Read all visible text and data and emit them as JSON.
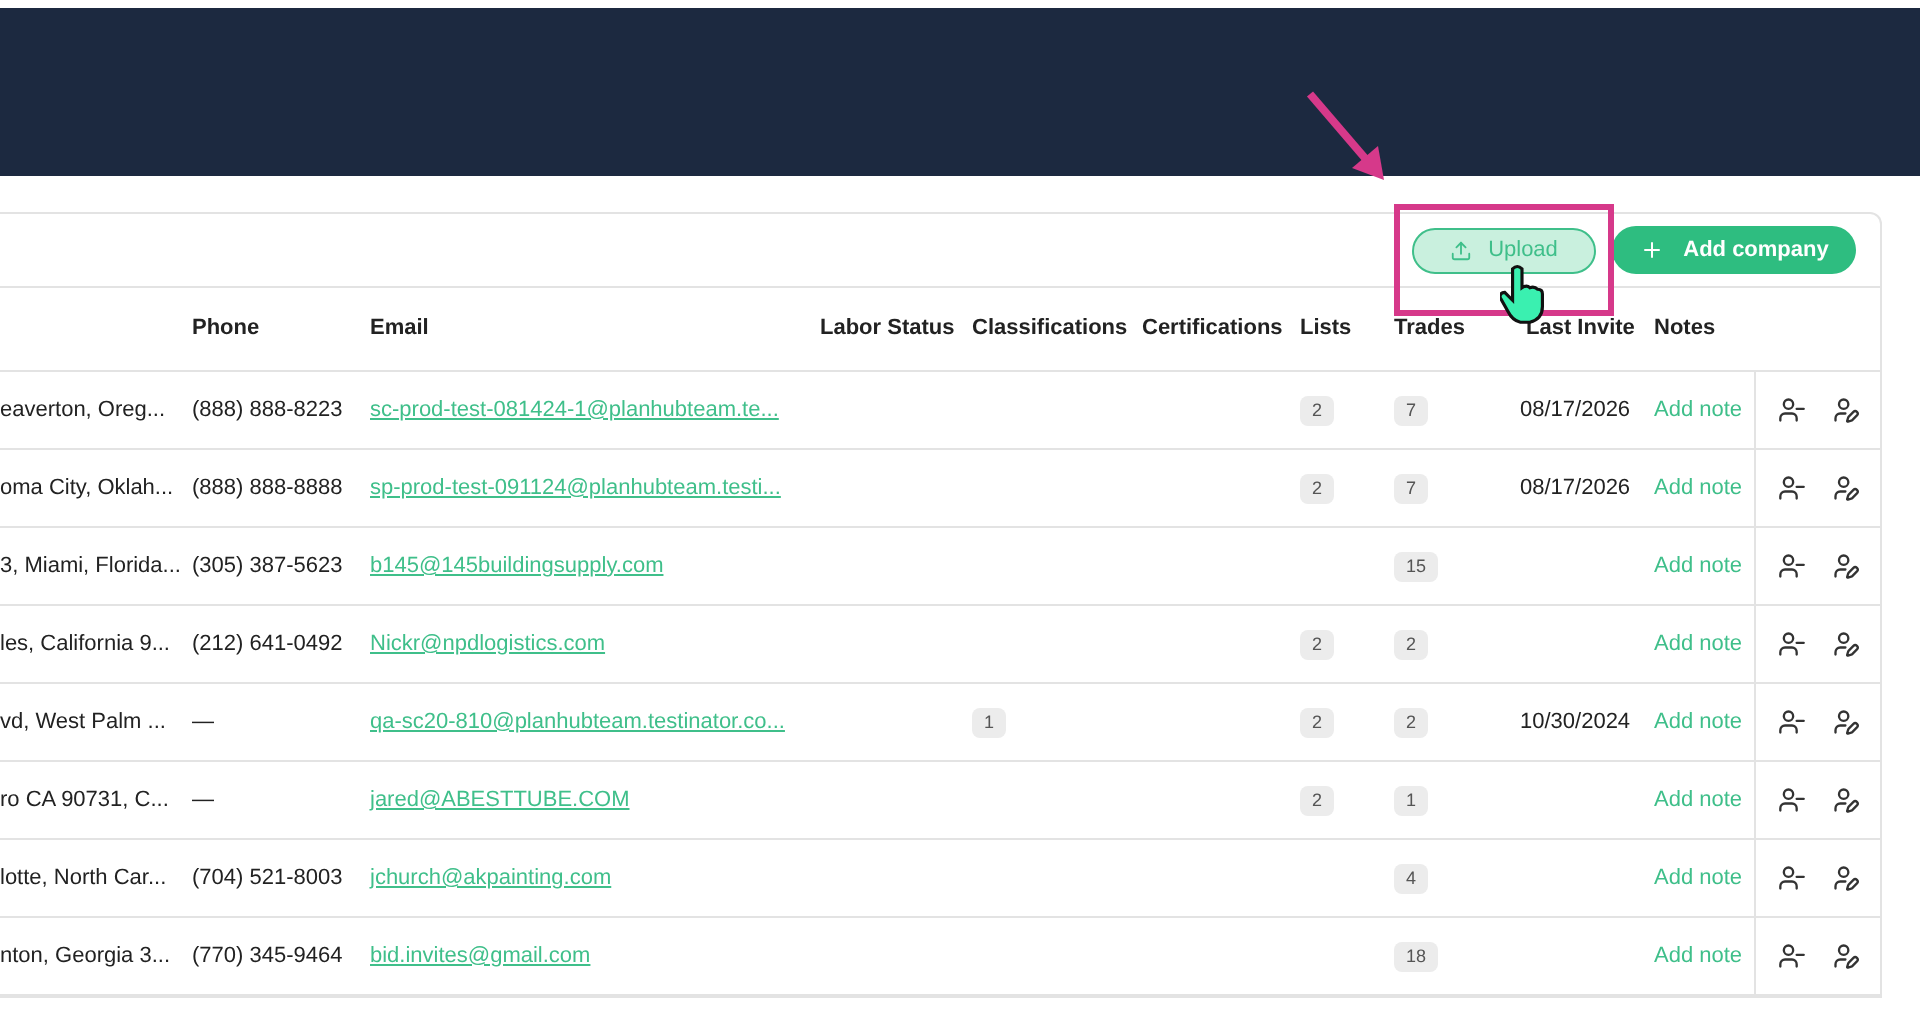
{
  "toolbar": {
    "upload_button": "Upload",
    "add_button": "Add company"
  },
  "table": {
    "columns": [
      "Phone",
      "Email",
      "Labor Status",
      "Classifications",
      "Certifications",
      "Lists",
      "Trades",
      "Last Invite",
      "Notes"
    ],
    "rows": [
      {
        "location": "eaverton, Oreg...",
        "phone": "(888) 888-8223",
        "email": "sc-prod-test-081424-1@planhubteam.te...",
        "lists": "2",
        "trades": "7",
        "last_invite": "08/17/2026",
        "note": "Add note"
      },
      {
        "location": "oma City, Oklah...",
        "phone": "(888) 888-8888",
        "email": "sp-prod-test-091124@planhubteam.testi...",
        "lists": "2",
        "trades": "7",
        "last_invite": "08/17/2026",
        "note": "Add note"
      },
      {
        "location": "3, Miami, Florida...",
        "phone": "(305) 387-5623",
        "email": "b145@145buildingsupply.com",
        "trades": "15",
        "note": "Add note"
      },
      {
        "location": "les, California 9...",
        "phone": "(212) 641-0492",
        "email": "Nickr@npdlogistics.com",
        "lists": "2",
        "trades": "2",
        "note": "Add note"
      },
      {
        "location": "vd, West Palm ...",
        "phone": "—",
        "email": "qa-sc20-810@planhubteam.testinator.co...",
        "classifications": "1",
        "lists": "2",
        "trades": "2",
        "last_invite": "10/30/2024",
        "note": "Add note"
      },
      {
        "location": "ro CA 90731, C...",
        "phone": "—",
        "email": "jared@ABESTTUBE.COM",
        "lists": "2",
        "trades": "1",
        "note": "Add note"
      },
      {
        "location": "lotte, North Car...",
        "phone": "(704) 521-8003",
        "email": "jchurch@akpainting.com",
        "trades": "4",
        "note": "Add note"
      },
      {
        "location": "nton, Georgia 3...",
        "phone": "(770) 345-9464",
        "email": "bid.invites@gmail.com",
        "trades": "18",
        "note": "Add note"
      }
    ]
  }
}
